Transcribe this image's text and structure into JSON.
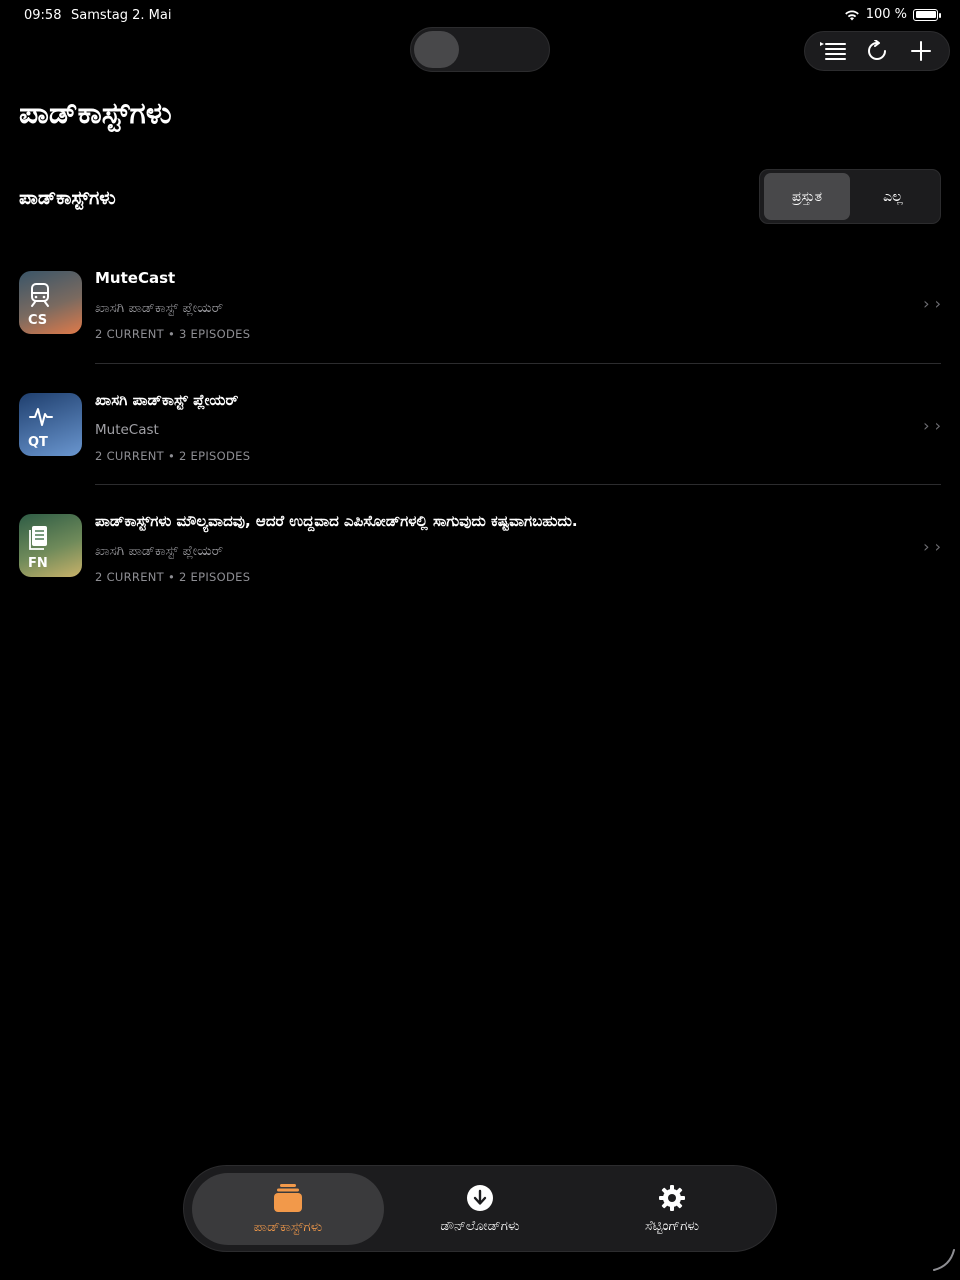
{
  "status": {
    "time": "09:58",
    "date": "Samstag 2. Mai",
    "battery": "100 %"
  },
  "toolbar": {
    "icons": [
      "list-icon",
      "refresh-icon",
      "plus-icon"
    ]
  },
  "page": {
    "title": "ಪಾಡ್‌ಕಾಸ್ಟ್‌ಗಳು",
    "section_title": "ಪಾಡ್‌ಕಾಸ್ಟ್‌ಗಳು"
  },
  "segment": {
    "options": [
      "ಪ್ರಸ್ತುತ",
      "ಎಲ್ಲ"
    ],
    "selected": "ಪ್ರಸ್ತುತ"
  },
  "podcasts": [
    {
      "abbr": "CS",
      "title": "MuteCast",
      "subtitle": "ಖಾಸಗಿ ಪಾಡ್‌ಕಾಸ್ಟ್ ಪ್ಲೇಯರ್",
      "meta": "2 CURRENT • 3 EPISODES",
      "icon": "train-icon",
      "colors": [
        "#3a5568",
        "#e07a4a"
      ]
    },
    {
      "abbr": "QT",
      "title": "ಖಾಸಗಿ ಪಾಡ್‌ಕಾಸ್ಟ್ ಪ್ಲೇಯರ್",
      "subtitle": "MuteCast",
      "meta": "2 CURRENT • 2 EPISODES",
      "icon": "pulse-icon",
      "colors": [
        "#1f3f6e",
        "#6a96cf"
      ]
    },
    {
      "abbr": "FN",
      "title": "ಪಾಡ್‌ಕಾಸ್ಟ್‌ಗಳು ಮೌಲ್ಯವಾದವು, ಆದರೆ ಉದ್ದವಾದ ಎಪಿಸೋಡ್‌ಗಳಲ್ಲಿ ಸಾಗುವುದು ಕಷ್ಟವಾಗಬಹುದು.",
      "subtitle": "ಖಾಸಗಿ ಪಾಡ್‌ಕಾಸ್ಟ್ ಪ್ಲೇಯರ್",
      "meta": "2 CURRENT • 2 EPISODES",
      "icon": "document-icon",
      "colors": [
        "#2e5c45",
        "#c9b26a"
      ]
    }
  ],
  "tabs": [
    {
      "label": "ಪಾಡ್‌ಕಾಸ್ಟ್‌ಗಳು",
      "icon": "stack-icon",
      "active": true
    },
    {
      "label": "ಡೌನ್‌ಲೋಡ್‌ಗಳು",
      "icon": "download-icon",
      "active": false
    },
    {
      "label": "ಸೆಟ್ಟಿಂಗ್‌ಗಳು",
      "icon": "gear-icon",
      "active": false
    }
  ],
  "colors": {
    "accent": "#f2994a",
    "background": "#000000",
    "surface": "#1c1c1e"
  }
}
